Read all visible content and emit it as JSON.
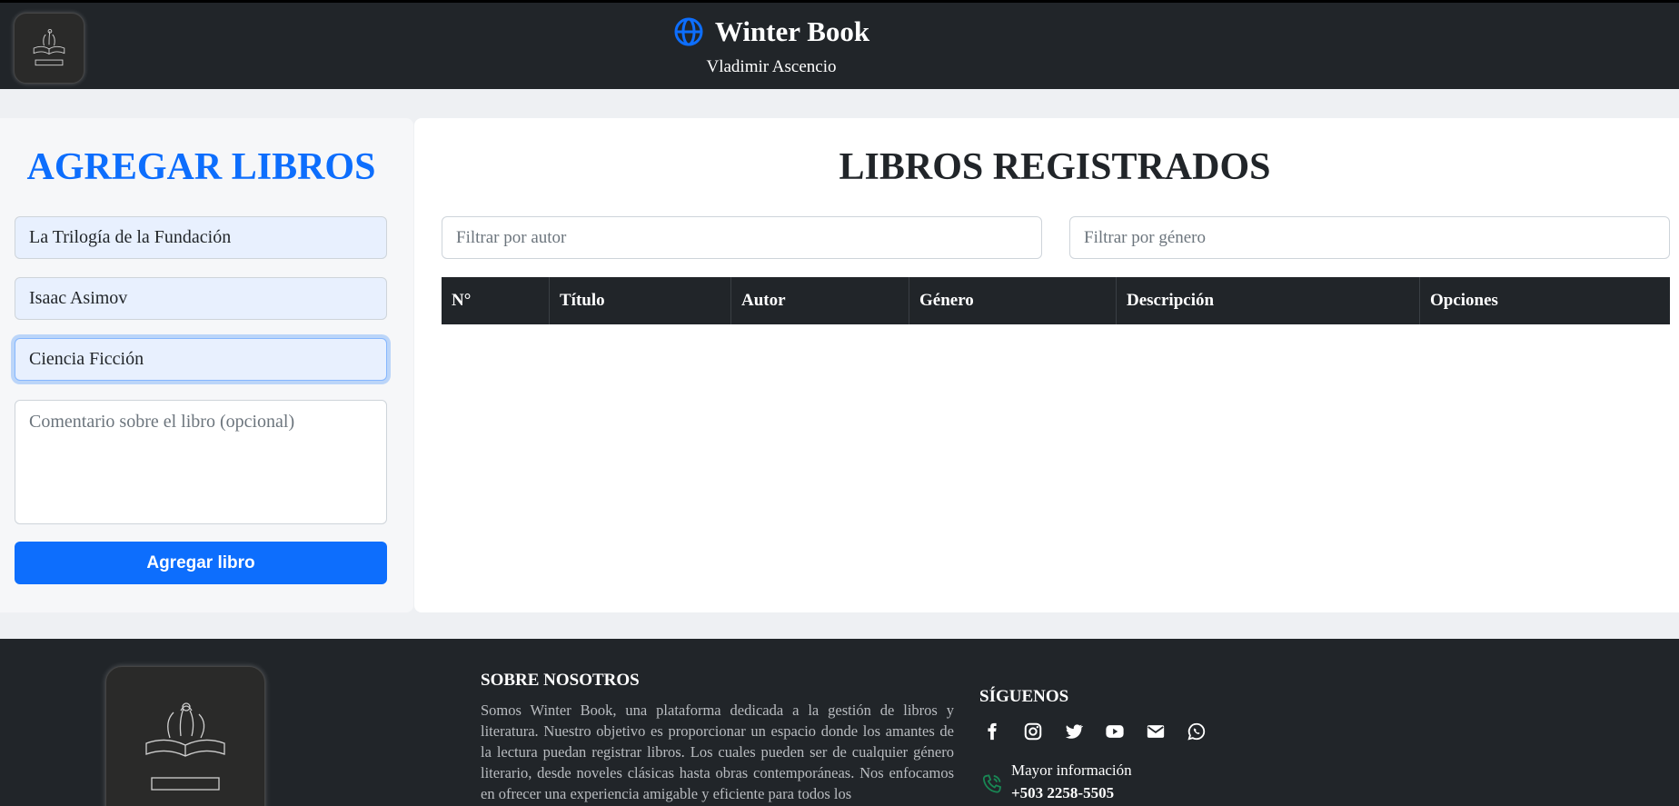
{
  "header": {
    "title": "Winter Book",
    "subtitle": "Vladimir Ascencio",
    "brand_color": "#0d6efd"
  },
  "form": {
    "heading": "AGREGAR LIBROS",
    "title_value": "La Trilogía de la Fundación",
    "author_value": "Isaac Asimov",
    "genre_value": "Ciencia Ficción",
    "comment_placeholder": "Comentario sobre el libro (opcional)",
    "submit_label": "Agregar libro"
  },
  "books": {
    "heading": "LIBROS REGISTRADOS",
    "filter_author_placeholder": "Filtrar por autor",
    "filter_genre_placeholder": "Filtrar por género",
    "columns": [
      "N°",
      "Título",
      "Autor",
      "Género",
      "Descripción",
      "Opciones"
    ],
    "rows": []
  },
  "footer": {
    "about_title": "SOBRE NOSOTROS",
    "about_text": "Somos Winter Book, una plataforma dedicada a la gestión de libros y literatura. Nuestro objetivo es proporcionar un espacio donde los amantes de la lectura puedan registrar libros. Los cuales pueden ser de cualquier género literario, desde noveles clásicas hasta obras contemporáneas. Nos enfocamos en ofrecer una experiencia amigable y eficiente para todos los",
    "follow_title": "SÍGUENOS",
    "social_icons": [
      "facebook-icon",
      "instagram-icon",
      "twitter-icon",
      "youtube-icon",
      "email-icon",
      "whatsapp-icon"
    ],
    "info_label": "Mayor información",
    "phone": "+503 2258-5505",
    "phone_icon_color": "#198754"
  }
}
